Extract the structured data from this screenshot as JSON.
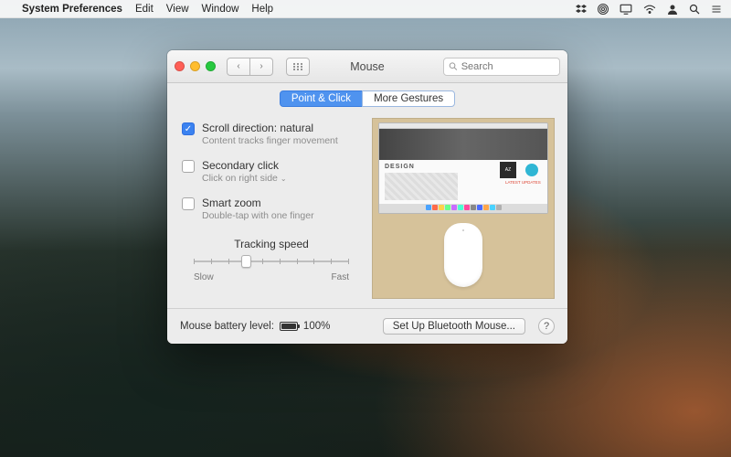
{
  "menubar": {
    "app_name": "System Preferences",
    "items": [
      "Edit",
      "View",
      "Window",
      "Help"
    ],
    "status_icons": [
      "dropbox-icon",
      "airdrop-icon",
      "display-icon",
      "wifi-icon",
      "user-icon",
      "spotlight-icon",
      "menu-icon"
    ]
  },
  "window": {
    "title": "Mouse",
    "search_placeholder": "Search",
    "nav": {
      "back": "‹",
      "forward": "›",
      "grid": "⋮⋮⋮"
    },
    "tabs": [
      {
        "label": "Point & Click",
        "active": true
      },
      {
        "label": "More Gestures",
        "active": false
      }
    ],
    "options": [
      {
        "id": "scroll",
        "checked": true,
        "title": "Scroll direction: natural",
        "subtitle": "Content tracks finger movement",
        "has_disclosure": false
      },
      {
        "id": "secondary",
        "checked": false,
        "title": "Secondary click",
        "subtitle": "Click on right side",
        "has_disclosure": true
      },
      {
        "id": "smartzoom",
        "checked": false,
        "title": "Smart zoom",
        "subtitle": "Double-tap with one finger",
        "has_disclosure": false
      }
    ],
    "tracking": {
      "label": "Tracking speed",
      "min_label": "Slow",
      "max_label": "Fast",
      "ticks": 10,
      "value_index": 3
    },
    "preview": {
      "design_label": "DESIGN",
      "badge_label": "AZ",
      "side_label": "LATEST UPDATES"
    },
    "footer": {
      "battery_label": "Mouse battery level:",
      "battery_value": "100%",
      "bluetooth_button": "Set Up Bluetooth Mouse...",
      "help": "?"
    }
  }
}
